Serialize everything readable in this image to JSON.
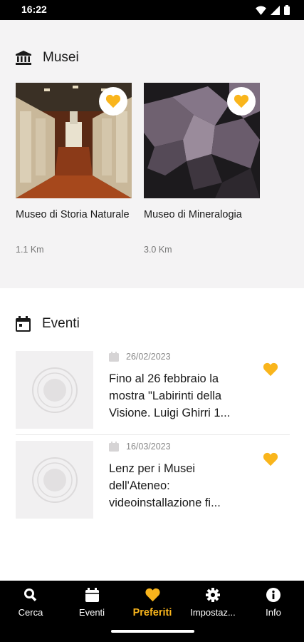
{
  "status_bar": {
    "time": "16:22"
  },
  "musei": {
    "title": "Musei",
    "items": [
      {
        "name": "Museo di Storia Naturale",
        "distance": "1.1 Km",
        "favorite": true
      },
      {
        "name": "Museo di Mineralogia",
        "distance": "3.0 Km",
        "favorite": true
      }
    ]
  },
  "eventi": {
    "title": "Eventi",
    "items": [
      {
        "date": "26/02/2023",
        "title": "Fino al 26 febbraio la mostra \"Labirinti della Visione. Luigi Ghirri 1...",
        "favorite": true
      },
      {
        "date": "16/03/2023",
        "title": "Lenz per i Musei dell'Ateneo: videoinstallazione fi...",
        "favorite": true
      }
    ]
  },
  "bottom_nav": {
    "items": [
      {
        "label": "Cerca",
        "icon": "search-icon"
      },
      {
        "label": "Eventi",
        "icon": "calendar-icon"
      },
      {
        "label": "Preferiti",
        "icon": "heart-icon",
        "active": true
      },
      {
        "label": "Impostaz...",
        "icon": "gear-icon"
      },
      {
        "label": "Info",
        "icon": "info-icon"
      }
    ]
  },
  "colors": {
    "accent": "#F9B51C",
    "nav_bg": "#000000",
    "section_bg": "#F4F3F4"
  }
}
